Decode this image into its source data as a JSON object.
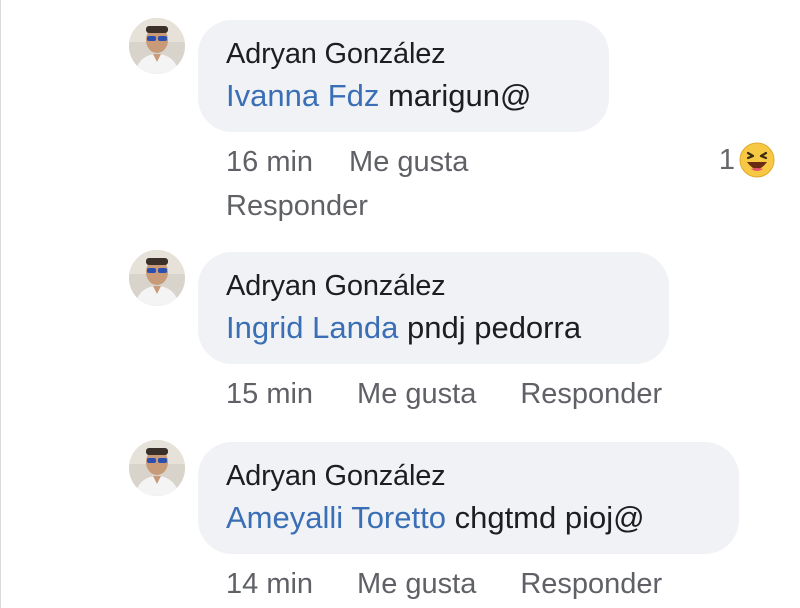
{
  "comments": [
    {
      "author": "Adryan González",
      "mention": "Ivanna Fdz",
      "text": " marigun@",
      "time": "16 min",
      "like_label": "Me gusta",
      "reply_label": "Responder",
      "reaction_count": "1",
      "reaction_icon": "laughing-emoji-icon"
    },
    {
      "author": "Adryan González",
      "mention": "Ingrid Landa",
      "text": " pndj pedorra",
      "time": "15 min",
      "like_label": "Me gusta",
      "reply_label": "Responder"
    },
    {
      "author": "Adryan González",
      "mention": "Ameyalli Toretto",
      "text": " chgtmd pioj@",
      "time": "14 min",
      "like_label": "Me gusta",
      "reply_label": "Responder"
    }
  ],
  "colors": {
    "bubble": "#f0f2f5",
    "mention": "#3a6fb5",
    "meta": "#5f6166",
    "author": "#1c1e21"
  }
}
